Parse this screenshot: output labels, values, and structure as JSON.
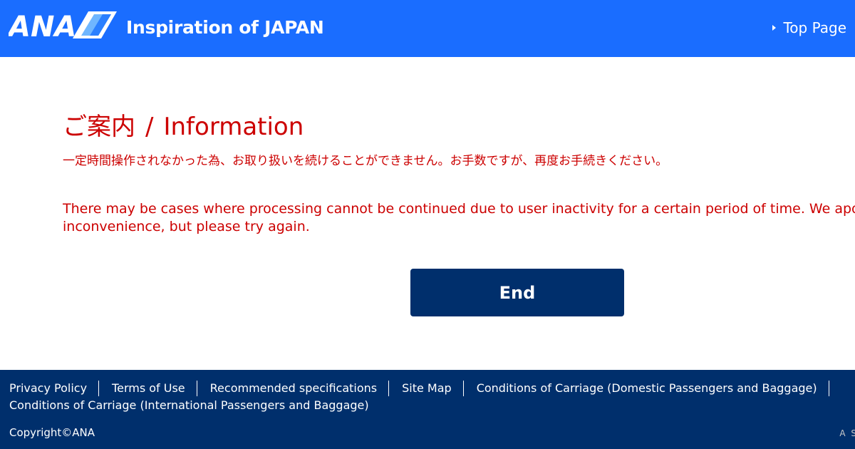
{
  "header": {
    "brand": "ANA",
    "tagline": "Inspiration of JAPAN",
    "top_link": "Top Page",
    "bg_color": "#1a6dff"
  },
  "main": {
    "heading_ja": "ご案内",
    "heading_sep": "/",
    "heading_en": "Information",
    "message_ja": "一定時間操作されなかった為、お取り扱いを続けることができません。お手数ですが、再度お手続きください。",
    "message_en_line1": "There may be cases where processing cannot be continued due to user inactivity for a certain period of time. We apologize for the",
    "message_en_line2": "inconvenience, but please try again.",
    "end_button": "End",
    "text_color": "#cc0000",
    "button_color": "#002f6c"
  },
  "footer": {
    "links_row1": [
      "Privacy Policy",
      "Terms of Use",
      "Recommended specifications",
      "Site Map",
      "Conditions of Carriage (Domestic Passengers and Baggage)"
    ],
    "links_row2": [
      "Conditions of Carriage (International Passengers and Baggage)"
    ],
    "copyright": "Copyright©ANA",
    "alliance": "A S",
    "bg_color": "#002f6c"
  }
}
